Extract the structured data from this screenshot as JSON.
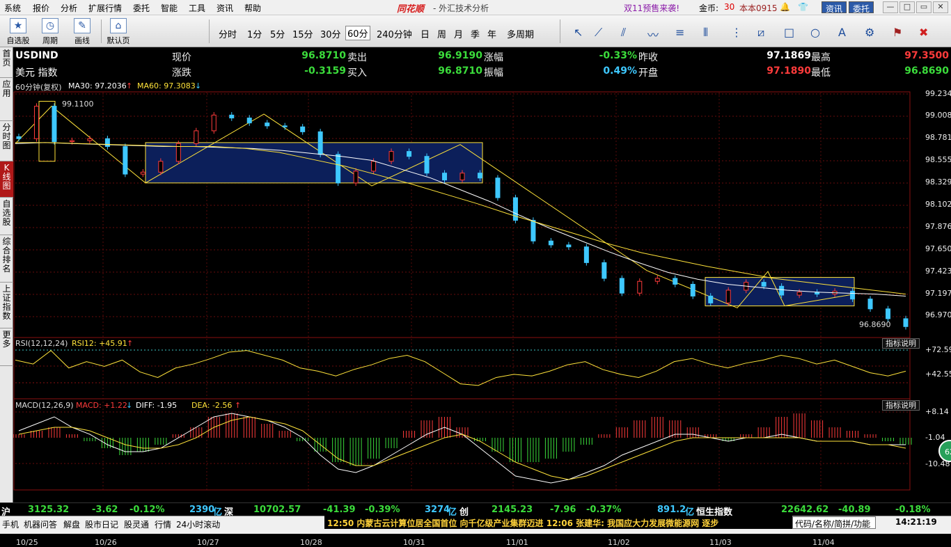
{
  "menu": [
    "系统",
    "报价",
    "分析",
    "扩展行情",
    "委托",
    "智能",
    "工具",
    "资讯",
    "帮助"
  ],
  "brand": "同花顺",
  "subtitle": "- 外汇技术分析",
  "promo": "双11预售来袭!",
  "gold_label": "金币:",
  "gold_count": "30",
  "version": "本本0915",
  "btn_news": "资讯",
  "btn_trade": "委托",
  "toolbar": {
    "favorites": "自选股",
    "cycle": "周期",
    "draw": "画线",
    "default": "默认页"
  },
  "periods": [
    "分时",
    "1分",
    "5分",
    "15分",
    "30分",
    "60分",
    "240分钟",
    "日",
    "周",
    "月",
    "季",
    "年",
    "多周期"
  ],
  "active_period": "60分",
  "sidebar": [
    "首页",
    "应用",
    "分时图",
    "K线图",
    "自选股",
    "综合排名",
    "上证指数",
    "更多"
  ],
  "quote": {
    "code": "USDIND",
    "name": "美元 指数",
    "price_label": "现价",
    "price": "96.8710",
    "sell_label": "卖出",
    "sell": "96.9190",
    "rise_label": "涨幅",
    "rise": "-0.33%",
    "prev_label": "昨收",
    "prev": "97.1869",
    "high_label": "最高",
    "high": "97.3500",
    "change_label": "涨跌",
    "change": "-0.3159",
    "buy_label": "买入",
    "buy": "96.8710",
    "amp_label": "振幅",
    "amp": "0.49%",
    "open_label": "开盘",
    "open": "97.1890",
    "low_label": "最低",
    "low": "96.8690"
  },
  "ma_legend": {
    "period": "60分钟(复权)",
    "ma30": "MA30: 97.2036",
    "ma60": "MA60: 97.3083"
  },
  "rsi_legend": {
    "title": "RSI(12,12,24)",
    "rsi12": "RSI12: +45.91"
  },
  "macd_legend": {
    "title": "MACD(12,26,9)",
    "macd": "MACD: +1.22",
    "diff": "DIFF: -1.95",
    "dea": "DEA: -2.56"
  },
  "explain_label": "指标说明",
  "annotations": {
    "high_mark": "99.1100",
    "low_mark": "96.8690"
  },
  "price_scale": [
    "99.2345",
    "99.0081",
    "98.7818",
    "98.5554",
    "98.3290",
    "98.1027",
    "97.8763",
    "97.6500",
    "97.4236",
    "97.1972",
    "96.9709"
  ],
  "rsi_scale": [
    "+72.59",
    "+42.55"
  ],
  "macd_scale": [
    "+8.14",
    "-1.04",
    "-10.48"
  ],
  "dates": [
    "10/25",
    "10/26",
    "10/27",
    "10/28",
    "10/31",
    "11/01",
    "11/02",
    "11/03",
    "11/04"
  ],
  "market": {
    "sh_label": "沪",
    "sh_val": "3125.32",
    "sh_chg": "-3.62",
    "sh_pct": "-0.12%",
    "sh_vol": "2390",
    "sh_unit": "亿",
    "sz_label": "深",
    "sz_val": "10702.57",
    "sz_chg": "-41.39",
    "sz_pct": "-0.39%",
    "sz_vol": "3274",
    "sz_unit": "亿",
    "cy_label": "创",
    "cy_val": "2145.23",
    "cy_chg": "-7.96",
    "cy_pct": "-0.37%",
    "cy_vol": "891.2",
    "cy_unit": "亿",
    "hs_label": "恒生指数",
    "hs_val": "22642.62",
    "hs_chg": "-40.89",
    "hs_pct": "-0.18%"
  },
  "taskbar": [
    "手机",
    "机器问答",
    "解盘",
    "股市日记",
    "股灵通",
    "行情",
    "24小时滚动"
  ],
  "news": "12:50 内蒙古云计算位居全国首位 向千亿级产业集群迈进        12:06 张建华: 我国应大力发展微能源网 逐步",
  "search_placeholder": "代码/名称/简拼/功能",
  "clock": "14:21:19",
  "float_ball": "62",
  "chart_data": [
    {
      "type": "candlestick",
      "title": "USDIND 60分钟",
      "x": [
        "10/25",
        "10/26",
        "10/27",
        "10/28",
        "10/31",
        "11/01",
        "11/02",
        "11/03",
        "11/04"
      ],
      "ylim": [
        96.87,
        99.23
      ],
      "series": [
        {
          "name": "Close",
          "values": [
            98.78,
            99.11,
            98.75,
            98.76,
            98.78,
            98.7,
            98.42,
            98.44,
            98.55,
            98.73,
            98.86,
            99.02,
            98.99,
            98.94,
            98.91,
            98.9,
            98.85,
            98.62,
            98.33,
            98.45,
            98.55,
            98.65,
            98.6,
            98.43,
            98.36,
            98.43,
            98.38,
            98.18,
            97.95,
            97.74,
            97.7,
            97.68,
            97.52,
            97.36,
            97.21,
            97.33,
            97.36,
            97.3,
            97.18,
            97.11,
            97.24,
            97.32,
            97.28,
            97.19,
            97.22,
            97.2,
            97.23,
            97.15,
            97.05,
            96.95,
            96.87
          ]
        },
        {
          "name": "MA30",
          "values": [
            98.73,
            98.74,
            98.73,
            98.72,
            98.71,
            98.7,
            98.7,
            98.69,
            98.68,
            98.66,
            98.63,
            98.6,
            98.56,
            98.47,
            98.38,
            98.26,
            98.14,
            98.0,
            97.87,
            97.75,
            97.63,
            97.52,
            97.42,
            97.35,
            97.3,
            97.27,
            97.24,
            97.22,
            97.21,
            97.2,
            97.18
          ]
        },
        {
          "name": "MA60",
          "values": [
            98.74,
            98.74,
            98.73,
            98.72,
            98.71,
            98.7,
            98.7,
            98.68,
            98.64,
            98.57,
            98.5,
            98.41,
            98.32,
            98.22,
            98.12,
            98.01,
            97.91,
            97.81,
            97.71,
            97.62,
            97.55,
            97.48,
            97.42,
            97.36,
            97.32,
            97.28,
            97.24,
            97.2
          ]
        }
      ],
      "high_mark": 99.11,
      "low_mark": 96.869
    },
    {
      "type": "line",
      "title": "RSI(12,12,24)",
      "ylim": [
        20,
        80
      ],
      "series": [
        {
          "name": "RSI12",
          "values": [
            60,
            55,
            72,
            50,
            58,
            52,
            60,
            45,
            38,
            50,
            55,
            62,
            70,
            72,
            66,
            60,
            50,
            46,
            40,
            48,
            54,
            62,
            66,
            58,
            44,
            30,
            28,
            38,
            42,
            40,
            46,
            54,
            58,
            48,
            42,
            38,
            46,
            58,
            62,
            55,
            50,
            56,
            60,
            66,
            62,
            55,
            60,
            52,
            44,
            40,
            46
          ]
        }
      ]
    },
    {
      "type": "bar",
      "title": "MACD(12,26,9)",
      "ylim": [
        -14,
        10
      ],
      "series": [
        {
          "name": "MACD",
          "values": [
            1,
            2,
            3,
            1,
            -1,
            -3,
            -5,
            -4,
            -2,
            1,
            3,
            6,
            7,
            6,
            4,
            2,
            -1,
            -4,
            -7,
            -8,
            -6,
            -3,
            2,
            5,
            6,
            3,
            -1,
            -4,
            -7,
            -7,
            -6,
            -4,
            -2,
            1,
            3,
            5,
            6,
            5,
            3,
            1,
            -1,
            1,
            3,
            6,
            7,
            5,
            3,
            2,
            1,
            -1,
            -2
          ]
        },
        {
          "name": "DIFF",
          "values": [
            2,
            4,
            6,
            3,
            1,
            -2,
            -4,
            -4,
            -3,
            0,
            3,
            6,
            7,
            6,
            5,
            3,
            0,
            -5,
            -9,
            -10,
            -8,
            -5,
            -2,
            1,
            3,
            1,
            -3,
            -7,
            -11,
            -12,
            -13,
            -12,
            -10,
            -8,
            -5,
            -3,
            -1,
            1,
            1,
            0,
            -1,
            0,
            0,
            1,
            0,
            -1,
            -1,
            -1,
            -2,
            -2,
            -2
          ]
        },
        {
          "name": "DEA",
          "values": [
            1,
            2,
            3,
            3,
            2,
            0,
            -2,
            -3,
            -3,
            -2,
            0,
            3,
            5,
            6,
            5,
            4,
            2,
            -2,
            -6,
            -8,
            -8,
            -6,
            -4,
            -2,
            0,
            1,
            -1,
            -4,
            -7,
            -9,
            -11,
            -12,
            -11,
            -9,
            -7,
            -5,
            -3,
            -1,
            0,
            0,
            0,
            0,
            0,
            0,
            0,
            -1,
            -1,
            -1,
            -2,
            -2,
            -3
          ]
        }
      ]
    }
  ]
}
